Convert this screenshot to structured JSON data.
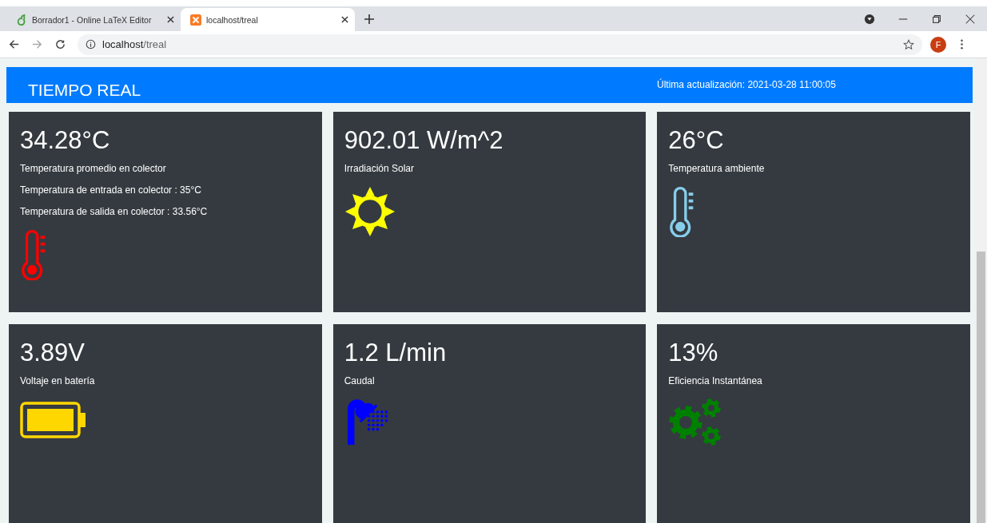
{
  "browser": {
    "tabs": [
      {
        "title": "Borrador1 - Online LaTeX Editor",
        "selected": false,
        "kind": "overleaf"
      },
      {
        "title": "localhost/treal",
        "selected": true,
        "kind": "xampp"
      }
    ],
    "url": {
      "host": "localhost",
      "path": "/treal"
    },
    "avatar": "F"
  },
  "header": {
    "title": "TIEMPO REAL",
    "updated": "Última actualización: 2021-03-28 11:00:05"
  },
  "cards": [
    {
      "value": "34.28°C",
      "label": "Temperatura promedio en colector",
      "details": [
        "Temperatura de entrada en colector : 35°C",
        "Temperatura de salida en colector : 33.56°C"
      ],
      "kind": "thermometer",
      "color": "#ff0000"
    },
    {
      "value": "902.01 W/m^2",
      "label": "Irradiación Solar",
      "kind": "sun",
      "color": "#ffff00"
    },
    {
      "value": "26°C",
      "label": "Temperatura ambiente",
      "kind": "thermometer",
      "color": "#87ceeb"
    },
    {
      "value": "3.89V",
      "label": "Voltaje en batería",
      "kind": "battery",
      "color": "#ffd700"
    },
    {
      "value": "1.2 L/min",
      "label": "Caudal",
      "kind": "shower",
      "color": "#0000ff"
    },
    {
      "value": "13%",
      "label": "Eficiencia Instantánea",
      "kind": "gears",
      "color": "#008000"
    }
  ]
}
